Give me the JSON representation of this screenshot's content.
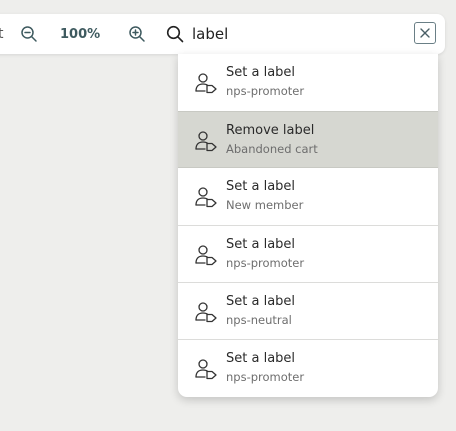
{
  "toolbar": {
    "partial_text": "t",
    "zoom_out_icon": "zoom-out-icon",
    "zoom_level": "100%",
    "zoom_in_icon": "zoom-in-icon",
    "search_icon": "search-icon",
    "search_value": "label",
    "clear_icon": "close-icon"
  },
  "dropdown": {
    "item_icon": "user-tag-icon",
    "items": [
      {
        "title": "Set a label",
        "subtitle": "nps-promoter",
        "selected": false
      },
      {
        "title": "Remove label",
        "subtitle": "Abandoned cart",
        "selected": true
      },
      {
        "title": "Set a label",
        "subtitle": "New member",
        "selected": false
      },
      {
        "title": "Set a label",
        "subtitle": "nps-promoter",
        "selected": false
      },
      {
        "title": "Set a label",
        "subtitle": "nps-neutral",
        "selected": false
      },
      {
        "title": "Set a label",
        "subtitle": "nps-promoter",
        "selected": false
      }
    ]
  },
  "colors": {
    "background": "#eeeeec",
    "toolbar_accent": "#3e5a5f",
    "selected_row": "#d6d7d1"
  }
}
